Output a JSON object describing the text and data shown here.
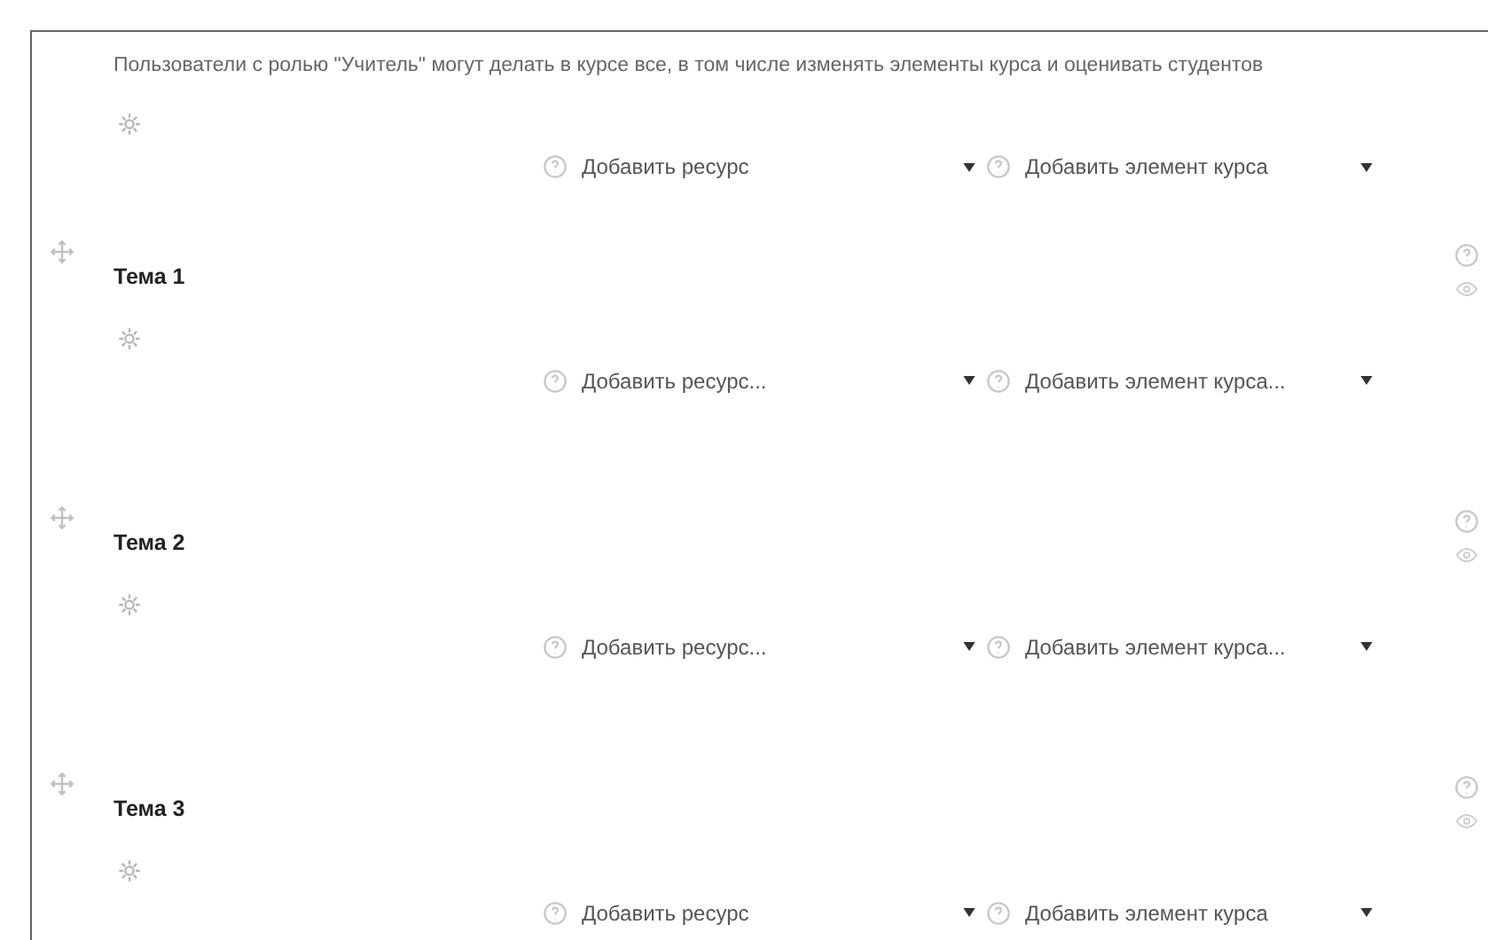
{
  "intro": {
    "text": "Пользователи с ролью \"Учитель\" могут делать в курсе все, в том числе изменять элементы курса и оценивать студентов",
    "add_resource": "Добавить ресурс",
    "add_activity": "Добавить элемент курса"
  },
  "sections": [
    {
      "title": "Тема 1",
      "add_resource": "Добавить ресурс...",
      "add_activity": "Добавить элемент курса..."
    },
    {
      "title": "Тема 2",
      "add_resource": "Добавить ресурс...",
      "add_activity": "Добавить элемент курса..."
    },
    {
      "title": "Тема 3",
      "add_resource": "Добавить ресурс",
      "add_activity": "Добавить элемент курса"
    }
  ]
}
